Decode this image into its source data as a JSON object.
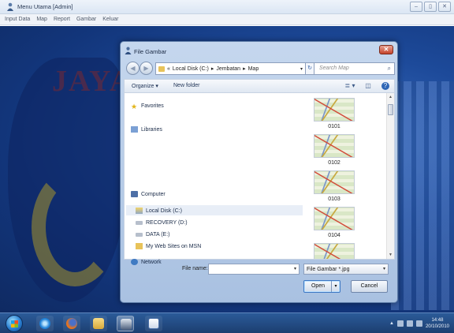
{
  "app": {
    "title": "Menu Utama [Admin]",
    "controls": [
      "–",
      "▯",
      "✕"
    ]
  },
  "menu": [
    "Input Data",
    "Map",
    "Report",
    "Gambar",
    "Keluar"
  ],
  "background": {
    "logo_text": "JAYA"
  },
  "dialog": {
    "title": "File Gambar",
    "close_glyph": "✕",
    "address": {
      "prefix": "«",
      "crumbs": [
        "Local Disk (C:)",
        "Jembatan",
        "Map"
      ],
      "separator": "▸",
      "dropdown_glyph": "▾"
    },
    "refresh_glyph": "↻",
    "search_placeholder": "Search Map",
    "search_glyph": "⌕",
    "toolbar": {
      "organize": "Organize ▾",
      "new_folder": "New folder",
      "view_glyph": "≣ ▾",
      "preview_glyph": "◫",
      "help_glyph": "?"
    },
    "nav": {
      "favorites": "Favorites",
      "libraries": "Libraries",
      "computer": "Computer",
      "drives": [
        "Local Disk (C:)",
        "RECOVERY (D:)",
        "DATA (E:)",
        "My Web Sites on MSN"
      ],
      "network": "Network",
      "selected": "Local Disk (C:)"
    },
    "files": [
      "0101",
      "0102",
      "0103",
      "0104"
    ],
    "filename_label": "File name:",
    "filename_value": "",
    "filetype": "File Gambar *.jpg",
    "open_label": "Open",
    "cancel_label": "Cancel",
    "dropdown_glyph": "▾"
  },
  "taskbar": {
    "apps": [
      "internet-explorer",
      "firefox",
      "windows-explorer",
      "menu-utama",
      "word-document"
    ],
    "active_app": "menu-utama",
    "tray_glyph": "▲",
    "time": "14:48",
    "date": "20/10/2010"
  }
}
